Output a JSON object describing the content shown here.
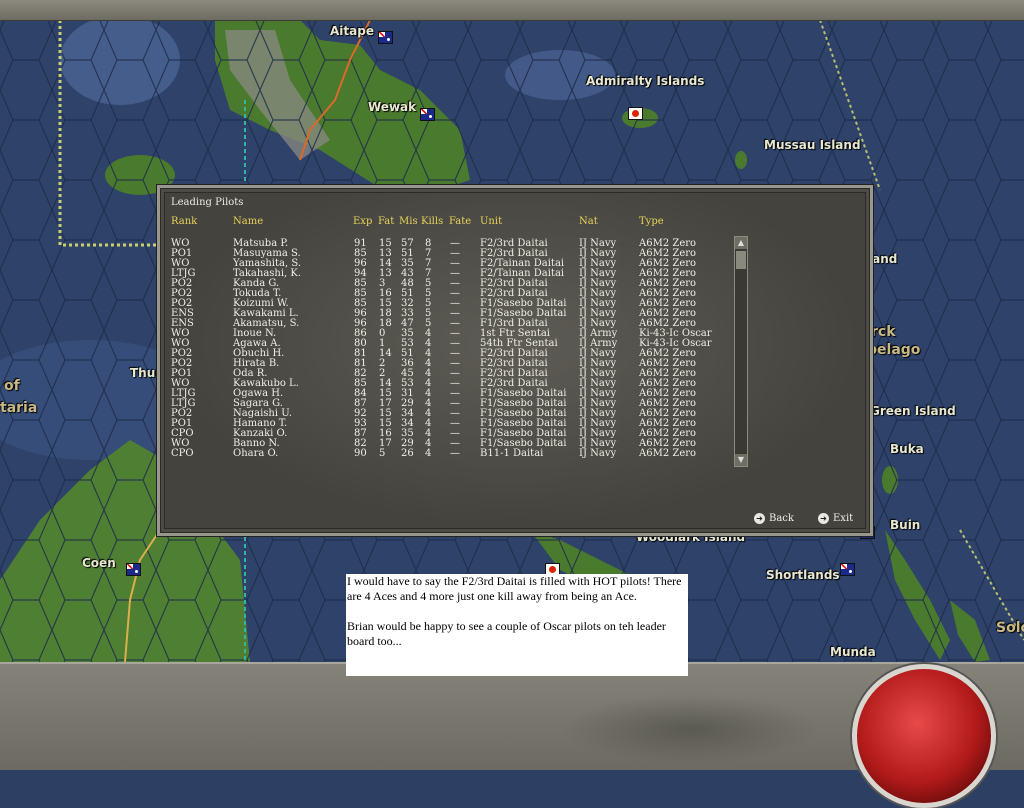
{
  "map": {
    "labels": [
      {
        "name": "Aitape"
      },
      {
        "name": "Wewak"
      },
      {
        "name": "Admiralty Islands"
      },
      {
        "name": "Mussau Island"
      },
      {
        "name": "land"
      },
      {
        "name": "rck"
      },
      {
        "name": "pelago"
      },
      {
        "name": "Green Island"
      },
      {
        "name": "Buka"
      },
      {
        "name": "Buin"
      },
      {
        "name": "Woodlark Island"
      },
      {
        "name": "Shortlands"
      },
      {
        "name": "Munda"
      },
      {
        "name": "Solo"
      },
      {
        "name": "Coen"
      },
      {
        "name": "Thur"
      },
      {
        "name": "of"
      },
      {
        "name": "taria"
      }
    ]
  },
  "window": {
    "title": "Leading Pilots",
    "headers": {
      "rank": "Rank",
      "name": "Name",
      "exp": "Exp",
      "fat": "Fat",
      "mis": "Mis",
      "kills": "Kills",
      "fate": "Fate",
      "unit": "Unit",
      "nat": "Nat",
      "type": "Type"
    },
    "pilots": [
      {
        "rank": "WO",
        "name": "Matsuba P.",
        "exp": "91",
        "fat": "15",
        "mis": "57",
        "kills": "8",
        "fate": "—",
        "unit": "F2/3rd Daitai",
        "nat": "IJ Navy",
        "type": "A6M2 Zero"
      },
      {
        "rank": "PO1",
        "name": "Masuyama S.",
        "exp": "85",
        "fat": "13",
        "mis": "51",
        "kills": "7",
        "fate": "—",
        "unit": "F2/3rd Daitai",
        "nat": "IJ Navy",
        "type": "A6M2 Zero"
      },
      {
        "rank": "WO",
        "name": "Yamashita, S.",
        "exp": "96",
        "fat": "14",
        "mis": "35",
        "kills": "7",
        "fate": "—",
        "unit": "F2/Tainan Daitai",
        "nat": "IJ Navy",
        "type": "A6M2 Zero"
      },
      {
        "rank": "LTJG",
        "name": "Takahashi, K.",
        "exp": "94",
        "fat": "13",
        "mis": "43",
        "kills": "7",
        "fate": "—",
        "unit": "F2/Tainan Daitai",
        "nat": "IJ Navy",
        "type": "A6M2 Zero"
      },
      {
        "rank": "PO2",
        "name": "Kanda G.",
        "exp": "85",
        "fat": "3",
        "mis": "48",
        "kills": "5",
        "fate": "—",
        "unit": "F2/3rd Daitai",
        "nat": "IJ Navy",
        "type": "A6M2 Zero"
      },
      {
        "rank": "PO2",
        "name": "Tokuda T.",
        "exp": "85",
        "fat": "16",
        "mis": "51",
        "kills": "5",
        "fate": "—",
        "unit": "F2/3rd Daitai",
        "nat": "IJ Navy",
        "type": "A6M2 Zero"
      },
      {
        "rank": "PO2",
        "name": "Koizumi W.",
        "exp": "85",
        "fat": "15",
        "mis": "32",
        "kills": "5",
        "fate": "—",
        "unit": "F1/Sasebo Daitai",
        "nat": "IJ Navy",
        "type": "A6M2 Zero"
      },
      {
        "rank": "ENS",
        "name": "Kawakami L.",
        "exp": "96",
        "fat": "18",
        "mis": "33",
        "kills": "5",
        "fate": "—",
        "unit": "F1/Sasebo Daitai",
        "nat": "IJ Navy",
        "type": "A6M2 Zero"
      },
      {
        "rank": "ENS",
        "name": "Akamatsu, S.",
        "exp": "96",
        "fat": "18",
        "mis": "47",
        "kills": "5",
        "fate": "—",
        "unit": "F1/3rd Daitai",
        "nat": "IJ Navy",
        "type": "A6M2 Zero"
      },
      {
        "rank": "WO",
        "name": "Inoue N.",
        "exp": "86",
        "fat": "0",
        "mis": "35",
        "kills": "4",
        "fate": "—",
        "unit": "1st Ftr Sentai",
        "nat": "IJ Army",
        "type": "Ki-43-Ic Oscar"
      },
      {
        "rank": "WO",
        "name": "Agawa A.",
        "exp": "80",
        "fat": "1",
        "mis": "53",
        "kills": "4",
        "fate": "—",
        "unit": "54th Ftr Sentai",
        "nat": "IJ Army",
        "type": "Ki-43-Ic Oscar"
      },
      {
        "rank": "PO2",
        "name": "Obuchi H.",
        "exp": "81",
        "fat": "14",
        "mis": "51",
        "kills": "4",
        "fate": "—",
        "unit": "F2/3rd Daitai",
        "nat": "IJ Navy",
        "type": "A6M2 Zero"
      },
      {
        "rank": "PO2",
        "name": "Hirata B.",
        "exp": "81",
        "fat": "2",
        "mis": "36",
        "kills": "4",
        "fate": "—",
        "unit": "F2/3rd Daitai",
        "nat": "IJ Navy",
        "type": "A6M2 Zero"
      },
      {
        "rank": "PO1",
        "name": "Oda R.",
        "exp": "82",
        "fat": "2",
        "mis": "45",
        "kills": "4",
        "fate": "—",
        "unit": "F2/3rd Daitai",
        "nat": "IJ Navy",
        "type": "A6M2 Zero"
      },
      {
        "rank": "WO",
        "name": "Kawakubo L.",
        "exp": "85",
        "fat": "14",
        "mis": "53",
        "kills": "4",
        "fate": "—",
        "unit": "F2/3rd Daitai",
        "nat": "IJ Navy",
        "type": "A6M2 Zero"
      },
      {
        "rank": "LTJG",
        "name": "Ogawa H.",
        "exp": "84",
        "fat": "15",
        "mis": "31",
        "kills": "4",
        "fate": "—",
        "unit": "F1/Sasebo Daitai",
        "nat": "IJ Navy",
        "type": "A6M2 Zero"
      },
      {
        "rank": "LTJG",
        "name": "Sagara G.",
        "exp": "87",
        "fat": "17",
        "mis": "29",
        "kills": "4",
        "fate": "—",
        "unit": "F1/Sasebo Daitai",
        "nat": "IJ Navy",
        "type": "A6M2 Zero"
      },
      {
        "rank": "PO2",
        "name": "Nagaishi U.",
        "exp": "92",
        "fat": "15",
        "mis": "34",
        "kills": "4",
        "fate": "—",
        "unit": "F1/Sasebo Daitai",
        "nat": "IJ Navy",
        "type": "A6M2 Zero"
      },
      {
        "rank": "PO1",
        "name": "Hamano T.",
        "exp": "93",
        "fat": "15",
        "mis": "34",
        "kills": "4",
        "fate": "—",
        "unit": "F1/Sasebo Daitai",
        "nat": "IJ Navy",
        "type": "A6M2 Zero"
      },
      {
        "rank": "CPO",
        "name": "Kanzaki O.",
        "exp": "87",
        "fat": "16",
        "mis": "35",
        "kills": "4",
        "fate": "—",
        "unit": "F1/Sasebo Daitai",
        "nat": "IJ Navy",
        "type": "A6M2 Zero"
      },
      {
        "rank": "WO",
        "name": "Banno N.",
        "exp": "82",
        "fat": "17",
        "mis": "29",
        "kills": "4",
        "fate": "—",
        "unit": "F1/Sasebo Daitai",
        "nat": "IJ Navy",
        "type": "A6M2 Zero"
      },
      {
        "rank": "CPO",
        "name": "Ohara O.",
        "exp": "90",
        "fat": "5",
        "mis": "26",
        "kills": "4",
        "fate": "—",
        "unit": "B11-1 Daitai",
        "nat": "IJ Navy",
        "type": "A6M2 Zero"
      }
    ],
    "back_label": "Back",
    "exit_label": "Exit"
  },
  "comment": {
    "line1": "I would have to say the F2/3rd Daitai is filled with HOT pilots! There are 4 Aces and 4 more just one kill away from being an Ace.",
    "line2": "Brian would be happy to see a couple of Oscar pilots on teh leader board too..."
  },
  "colors": {
    "header": "#e8d25a",
    "sea": "#2d3f63",
    "land": "#4a7a2e",
    "panel": "#4c4b46",
    "end_turn": "#c92222"
  }
}
